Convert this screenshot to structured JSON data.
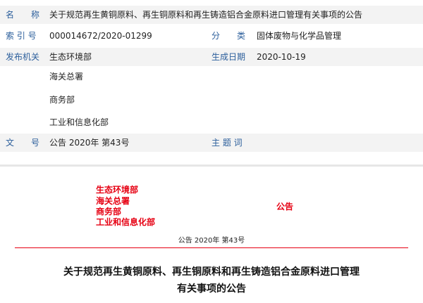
{
  "meta": {
    "name_label": "名　　称",
    "name_value": "关于规范再生黄铜原料、再生铜原料和再生铸造铝合金原料进口管理有关事项的公告",
    "index_label": "索 引 号",
    "index_value": "000014672/2020-01299",
    "category_label": "分　　类",
    "category_value": "固体废物与化学品管理",
    "issuer_label": "发布机关",
    "issuers": [
      "生态环境部",
      "海关总署",
      "商务部",
      "工业和信息化部"
    ],
    "date_label": "生成日期",
    "date_value": "2020-10-19",
    "docno_label": "文　　号",
    "docno_value": "公告 2020年 第43号",
    "topic_label": "主 题 词",
    "topic_value": ""
  },
  "document": {
    "issuers": [
      "生态环境部",
      "海关总署",
      "商务部",
      "工业和信息化部"
    ],
    "notice_word": "公告",
    "docno": "公告 2020年 第43号",
    "title_line1": "关于规范再生黄铜原料、再生铜原料和再生铸造铝合金原料进口管理",
    "title_line2": "有关事项的公告"
  },
  "colors": {
    "label_blue": "#2b5e9b",
    "row_gray": "#f3f3f3",
    "official_red": "#e60012"
  }
}
